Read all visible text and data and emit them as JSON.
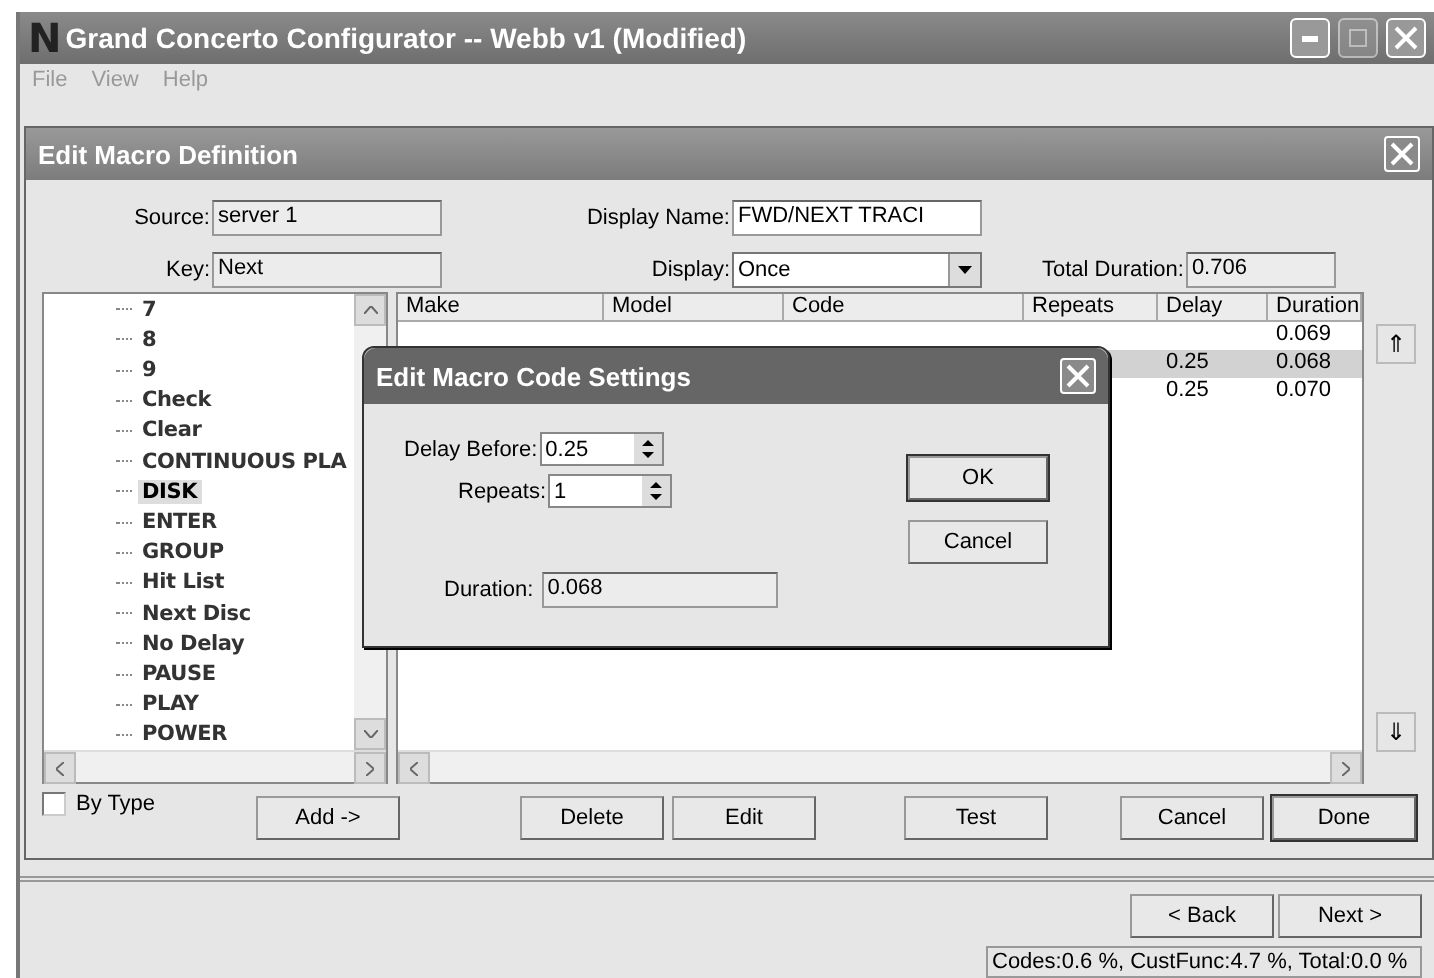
{
  "window": {
    "title": "Grand Concerto Configurator -- Webb v1 (Modified)",
    "logo": "N"
  },
  "menu": [
    "File",
    "View",
    "Help"
  ],
  "dialog": {
    "title": "Edit Macro Definition",
    "source": {
      "label": "Source:",
      "value": "server 1"
    },
    "key": {
      "label": "Key:",
      "value": "Next"
    },
    "display_name": {
      "label": "Display Name:",
      "value": "FWD/NEXT TRACI"
    },
    "display": {
      "label": "Display:",
      "value": "Once"
    },
    "total_duration": {
      "label": "Total Duration:",
      "value": "0.706"
    },
    "tree_items": [
      {
        "label": "7",
        "selected": false
      },
      {
        "label": "8",
        "selected": false
      },
      {
        "label": "9",
        "selected": false
      },
      {
        "label": "Check",
        "selected": false
      },
      {
        "label": "Clear",
        "selected": false
      },
      {
        "label": "CONTINUOUS PLA",
        "selected": false
      },
      {
        "label": "DISK",
        "selected": true
      },
      {
        "label": "ENTER",
        "selected": false
      },
      {
        "label": "GROUP",
        "selected": false
      },
      {
        "label": "Hit List",
        "selected": false
      },
      {
        "label": "Next Disc",
        "selected": false
      },
      {
        "label": "No Delay",
        "selected": false
      },
      {
        "label": "PAUSE",
        "selected": false
      },
      {
        "label": "PLAY",
        "selected": false
      },
      {
        "label": "POWER",
        "selected": false
      }
    ],
    "table": {
      "columns": [
        "Make",
        "Model",
        "Code",
        "Repeats",
        "Delay",
        "Duration"
      ],
      "rows": [
        {
          "delay": "",
          "duration": "0.069",
          "selected": false
        },
        {
          "delay": "0.25",
          "duration": "0.068",
          "selected": true
        },
        {
          "delay": "0.25",
          "duration": "0.070",
          "selected": false
        }
      ]
    },
    "move_up": "⇑",
    "move_down": "⇓",
    "by_type": {
      "label": "By Type",
      "checked": false
    },
    "buttons": [
      {
        "label": "Add ->",
        "default": false
      },
      {
        "label": "Delete",
        "default": false
      },
      {
        "label": "Edit",
        "default": false
      },
      {
        "label": "Test",
        "default": false
      },
      {
        "label": "Cancel",
        "default": false
      },
      {
        "label": "Done",
        "default": true
      }
    ]
  },
  "popup": {
    "title": "Edit Macro Code Settings",
    "delay_before": {
      "label": "Delay Before:",
      "value": "0.25"
    },
    "repeats": {
      "label": "Repeats:",
      "value": "1"
    },
    "duration": {
      "label": "Duration:",
      "value": "0.068"
    },
    "buttons": [
      {
        "label": "OK",
        "default": true
      },
      {
        "label": "Cancel",
        "default": false
      }
    ]
  },
  "nav_buttons": [
    "< Back",
    "Next >"
  ],
  "status_bar": "Codes:0.6 %, CustFunc:4.7 %, Total:0.0 %"
}
